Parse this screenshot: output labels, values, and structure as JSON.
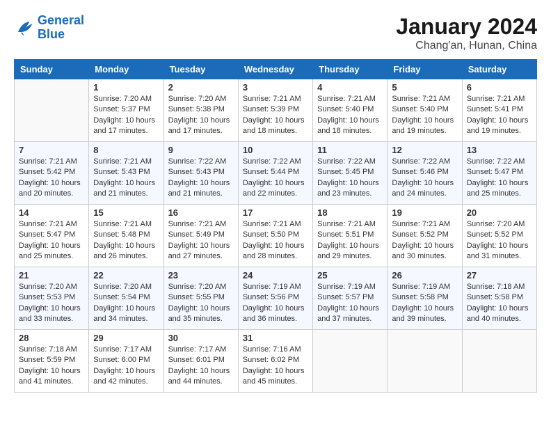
{
  "header": {
    "logo_line1": "General",
    "logo_line2": "Blue",
    "month_title": "January 2024",
    "location": "Chang'an, Hunan, China"
  },
  "days_of_week": [
    "Sunday",
    "Monday",
    "Tuesday",
    "Wednesday",
    "Thursday",
    "Friday",
    "Saturday"
  ],
  "weeks": [
    [
      {
        "day": "",
        "sunrise": "",
        "sunset": "",
        "daylight": ""
      },
      {
        "day": "1",
        "sunrise": "Sunrise: 7:20 AM",
        "sunset": "Sunset: 5:37 PM",
        "daylight": "Daylight: 10 hours and 17 minutes."
      },
      {
        "day": "2",
        "sunrise": "Sunrise: 7:20 AM",
        "sunset": "Sunset: 5:38 PM",
        "daylight": "Daylight: 10 hours and 17 minutes."
      },
      {
        "day": "3",
        "sunrise": "Sunrise: 7:21 AM",
        "sunset": "Sunset: 5:39 PM",
        "daylight": "Daylight: 10 hours and 18 minutes."
      },
      {
        "day": "4",
        "sunrise": "Sunrise: 7:21 AM",
        "sunset": "Sunset: 5:40 PM",
        "daylight": "Daylight: 10 hours and 18 minutes."
      },
      {
        "day": "5",
        "sunrise": "Sunrise: 7:21 AM",
        "sunset": "Sunset: 5:40 PM",
        "daylight": "Daylight: 10 hours and 19 minutes."
      },
      {
        "day": "6",
        "sunrise": "Sunrise: 7:21 AM",
        "sunset": "Sunset: 5:41 PM",
        "daylight": "Daylight: 10 hours and 19 minutes."
      }
    ],
    [
      {
        "day": "7",
        "sunrise": "Sunrise: 7:21 AM",
        "sunset": "Sunset: 5:42 PM",
        "daylight": "Daylight: 10 hours and 20 minutes."
      },
      {
        "day": "8",
        "sunrise": "Sunrise: 7:21 AM",
        "sunset": "Sunset: 5:43 PM",
        "daylight": "Daylight: 10 hours and 21 minutes."
      },
      {
        "day": "9",
        "sunrise": "Sunrise: 7:22 AM",
        "sunset": "Sunset: 5:43 PM",
        "daylight": "Daylight: 10 hours and 21 minutes."
      },
      {
        "day": "10",
        "sunrise": "Sunrise: 7:22 AM",
        "sunset": "Sunset: 5:44 PM",
        "daylight": "Daylight: 10 hours and 22 minutes."
      },
      {
        "day": "11",
        "sunrise": "Sunrise: 7:22 AM",
        "sunset": "Sunset: 5:45 PM",
        "daylight": "Daylight: 10 hours and 23 minutes."
      },
      {
        "day": "12",
        "sunrise": "Sunrise: 7:22 AM",
        "sunset": "Sunset: 5:46 PM",
        "daylight": "Daylight: 10 hours and 24 minutes."
      },
      {
        "day": "13",
        "sunrise": "Sunrise: 7:22 AM",
        "sunset": "Sunset: 5:47 PM",
        "daylight": "Daylight: 10 hours and 25 minutes."
      }
    ],
    [
      {
        "day": "14",
        "sunrise": "Sunrise: 7:21 AM",
        "sunset": "Sunset: 5:47 PM",
        "daylight": "Daylight: 10 hours and 25 minutes."
      },
      {
        "day": "15",
        "sunrise": "Sunrise: 7:21 AM",
        "sunset": "Sunset: 5:48 PM",
        "daylight": "Daylight: 10 hours and 26 minutes."
      },
      {
        "day": "16",
        "sunrise": "Sunrise: 7:21 AM",
        "sunset": "Sunset: 5:49 PM",
        "daylight": "Daylight: 10 hours and 27 minutes."
      },
      {
        "day": "17",
        "sunrise": "Sunrise: 7:21 AM",
        "sunset": "Sunset: 5:50 PM",
        "daylight": "Daylight: 10 hours and 28 minutes."
      },
      {
        "day": "18",
        "sunrise": "Sunrise: 7:21 AM",
        "sunset": "Sunset: 5:51 PM",
        "daylight": "Daylight: 10 hours and 29 minutes."
      },
      {
        "day": "19",
        "sunrise": "Sunrise: 7:21 AM",
        "sunset": "Sunset: 5:52 PM",
        "daylight": "Daylight: 10 hours and 30 minutes."
      },
      {
        "day": "20",
        "sunrise": "Sunrise: 7:20 AM",
        "sunset": "Sunset: 5:52 PM",
        "daylight": "Daylight: 10 hours and 31 minutes."
      }
    ],
    [
      {
        "day": "21",
        "sunrise": "Sunrise: 7:20 AM",
        "sunset": "Sunset: 5:53 PM",
        "daylight": "Daylight: 10 hours and 33 minutes."
      },
      {
        "day": "22",
        "sunrise": "Sunrise: 7:20 AM",
        "sunset": "Sunset: 5:54 PM",
        "daylight": "Daylight: 10 hours and 34 minutes."
      },
      {
        "day": "23",
        "sunrise": "Sunrise: 7:20 AM",
        "sunset": "Sunset: 5:55 PM",
        "daylight": "Daylight: 10 hours and 35 minutes."
      },
      {
        "day": "24",
        "sunrise": "Sunrise: 7:19 AM",
        "sunset": "Sunset: 5:56 PM",
        "daylight": "Daylight: 10 hours and 36 minutes."
      },
      {
        "day": "25",
        "sunrise": "Sunrise: 7:19 AM",
        "sunset": "Sunset: 5:57 PM",
        "daylight": "Daylight: 10 hours and 37 minutes."
      },
      {
        "day": "26",
        "sunrise": "Sunrise: 7:19 AM",
        "sunset": "Sunset: 5:58 PM",
        "daylight": "Daylight: 10 hours and 39 minutes."
      },
      {
        "day": "27",
        "sunrise": "Sunrise: 7:18 AM",
        "sunset": "Sunset: 5:58 PM",
        "daylight": "Daylight: 10 hours and 40 minutes."
      }
    ],
    [
      {
        "day": "28",
        "sunrise": "Sunrise: 7:18 AM",
        "sunset": "Sunset: 5:59 PM",
        "daylight": "Daylight: 10 hours and 41 minutes."
      },
      {
        "day": "29",
        "sunrise": "Sunrise: 7:17 AM",
        "sunset": "Sunset: 6:00 PM",
        "daylight": "Daylight: 10 hours and 42 minutes."
      },
      {
        "day": "30",
        "sunrise": "Sunrise: 7:17 AM",
        "sunset": "Sunset: 6:01 PM",
        "daylight": "Daylight: 10 hours and 44 minutes."
      },
      {
        "day": "31",
        "sunrise": "Sunrise: 7:16 AM",
        "sunset": "Sunset: 6:02 PM",
        "daylight": "Daylight: 10 hours and 45 minutes."
      },
      {
        "day": "",
        "sunrise": "",
        "sunset": "",
        "daylight": ""
      },
      {
        "day": "",
        "sunrise": "",
        "sunset": "",
        "daylight": ""
      },
      {
        "day": "",
        "sunrise": "",
        "sunset": "",
        "daylight": ""
      }
    ]
  ]
}
